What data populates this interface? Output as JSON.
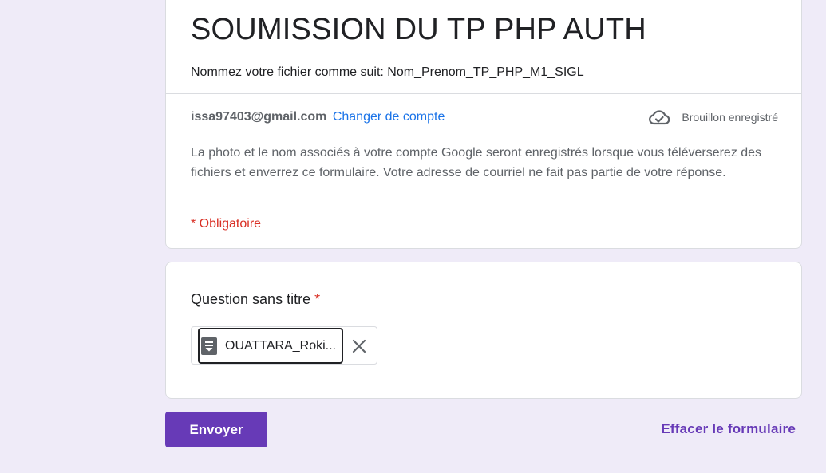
{
  "form": {
    "title": "SOUMISSION DU TP PHP AUTH",
    "description": "Nommez votre fichier comme suit: Nom_Prenom_TP_PHP_M1_SIGL"
  },
  "account": {
    "email": "issa97403@gmail.com",
    "switch_label": "Changer de compte"
  },
  "draft_status": {
    "label": "Brouillon enregistré",
    "icon": "cloud-check-icon"
  },
  "notice": "La photo et le nom associés à votre compte Google seront enregistrés lorsque vous téléverserez des fichiers et enverrez ce formulaire. Votre adresse de courriel ne fait pas partie de votre réponse.",
  "required_note": "* Obligatoire",
  "question": {
    "title": "Question sans titre",
    "required_marker": "*",
    "file": {
      "name": "OUATTARA_Roki...",
      "icon": "document-icon",
      "remove_icon": "close-icon"
    }
  },
  "actions": {
    "submit_label": "Envoyer",
    "clear_label": "Effacer le formulaire"
  },
  "colors": {
    "background": "#efebf8",
    "accent": "#673ab7",
    "link": "#1a73e8",
    "required": "#d93025"
  }
}
